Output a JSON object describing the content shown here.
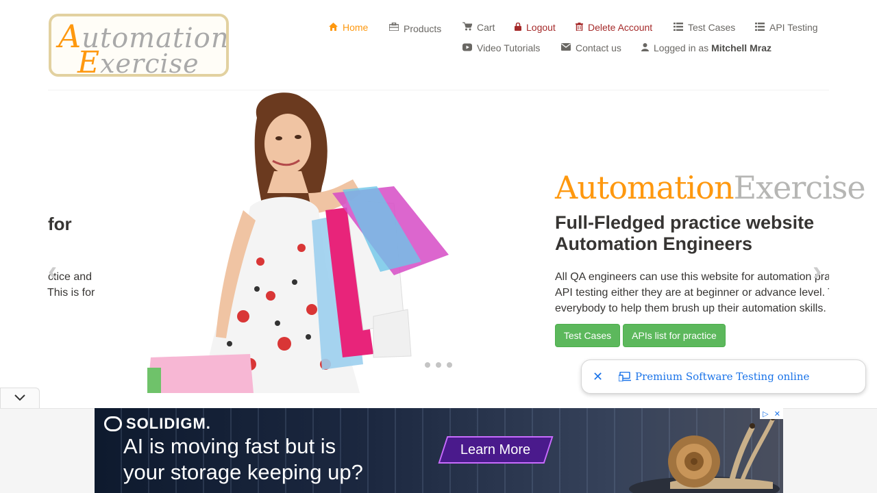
{
  "header": {
    "logo": {
      "word1": "utomation",
      "cap1": "A",
      "word2": "xercise",
      "cap2": "E"
    },
    "nav": {
      "home": "Home",
      "products": "Products",
      "cart": "Cart",
      "logout": "Logout",
      "delete_account": "Delete Account",
      "test_cases": "Test Cases",
      "api_testing": "API Testing",
      "video_tutorials": "Video Tutorials",
      "contact_us": "Contact us",
      "logged_in_prefix": "Logged in as",
      "username": "Mitchell Mraz"
    },
    "icons": {
      "home": "home-icon",
      "products": "briefcase-icon",
      "cart": "cart-icon",
      "logout": "lock-icon",
      "delete": "trash-icon",
      "test_cases": "list-icon",
      "api_testing": "list-icon",
      "video": "youtube-play-icon",
      "contact": "envelope-icon",
      "user": "user-icon"
    }
  },
  "slider": {
    "ghost_title": "for",
    "ghost_line1": "ctice and",
    "ghost_line2": "This is for",
    "brand_a": "Automation",
    "brand_e": "Exercise",
    "headline_line1": "Full-Fledged practice website",
    "headline_line2": "Automation Engineers",
    "desc_line1": "All QA engineers can use this website for automation pra",
    "desc_line2": "API testing either they are at beginner or advance level. T",
    "desc_line3": "everybody to help them brush up their automation skills.",
    "btn_test_cases": "Test Cases",
    "btn_apis": "APIs list for practice",
    "prev_arrow": "‹",
    "next_arrow": "›",
    "dots": 3
  },
  "premium_chip": {
    "text": "Premium Software Testing online"
  },
  "ad": {
    "brand": "SOLIDIGM.",
    "line1": "AI is moving fast but is",
    "line2": "your storage keeping up?",
    "cta": "Learn More"
  },
  "colors": {
    "accent": "#fe980f",
    "danger": "#a52a2a",
    "button_green": "#5cb85c",
    "link_blue": "#1a73e8"
  }
}
